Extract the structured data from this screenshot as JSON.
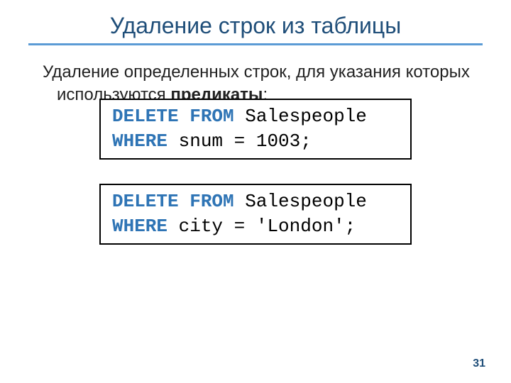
{
  "title": "Удаление строк из таблицы",
  "paragraph": {
    "lead": "Удаление определенных строк, для указания которых используются ",
    "bold": "предикаты",
    "tail": ":"
  },
  "code1": {
    "kw_delete_from": "DELETE FROM",
    "table": " Salespeople",
    "kw_where": "WHERE",
    "cond": " snum = 1003;"
  },
  "code2": {
    "kw_delete_from": "DELETE FROM",
    "table": " Salespeople",
    "kw_where": "WHERE",
    "cond": " city = 'London';"
  },
  "page_number": "31"
}
